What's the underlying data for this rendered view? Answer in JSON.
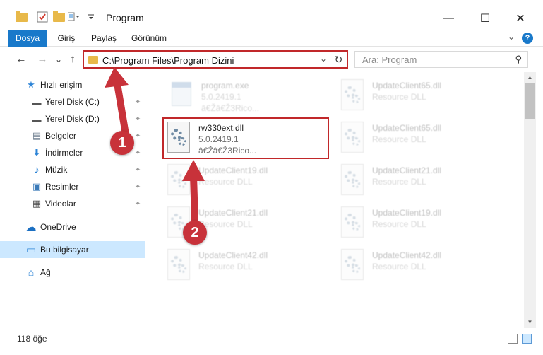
{
  "window": {
    "title": "Program",
    "minimize_glyph": "—",
    "maximize_glyph": "☐",
    "close_glyph": "✕"
  },
  "ribbon": {
    "tabs": [
      {
        "label": "Dosya"
      },
      {
        "label": "Giriş"
      },
      {
        "label": "Paylaş"
      },
      {
        "label": "Görünüm"
      }
    ],
    "help_glyph": "?",
    "collapse_glyph": "⌄"
  },
  "nav": {
    "back": "←",
    "forward": "→",
    "recent": "⌄",
    "up": "↑",
    "address": "C:\\Program Files\\Program Dizini",
    "address_dropdown": "⌄",
    "refresh": "↻",
    "search_placeholder": "Ara: Program",
    "search_glyph": "⚲"
  },
  "sidebar": {
    "items": [
      {
        "label": "Hızlı erişim",
        "icon": "star-icon",
        "glyph": "★",
        "color": "#2d84d6"
      },
      {
        "label": "Yerel Disk (C:)",
        "icon": "drive-icon",
        "glyph": "▬",
        "color": "#555555",
        "pinned": true
      },
      {
        "label": "Yerel Disk (D:)",
        "icon": "drive-icon",
        "glyph": "▬",
        "color": "#555555",
        "pinned": true
      },
      {
        "label": "Belgeler",
        "icon": "documents-icon",
        "glyph": "▤",
        "color": "#6b7b8c",
        "pinned": true
      },
      {
        "label": "İndirmeler",
        "icon": "download-icon",
        "glyph": "⬇",
        "color": "#2d84d6",
        "pinned": true
      },
      {
        "label": "Müzik",
        "icon": "music-icon",
        "glyph": "♪",
        "color": "#2d84d6",
        "pinned": true
      },
      {
        "label": "Resimler",
        "icon": "pictures-icon",
        "glyph": "▣",
        "color": "#3a7ab8",
        "pinned": true
      },
      {
        "label": "Videolar",
        "icon": "videos-icon",
        "glyph": "▦",
        "color": "#444444",
        "pinned": true
      },
      {
        "label": "OneDrive",
        "icon": "cloud-icon",
        "glyph": "☁",
        "color": "#1b6fc2"
      },
      {
        "label": "Bu bilgisayar",
        "icon": "computer-icon",
        "glyph": "▭",
        "color": "#2d84d6",
        "selected": true
      },
      {
        "label": "Ağ",
        "icon": "network-icon",
        "glyph": "⌂",
        "color": "#2d84d6"
      }
    ],
    "pin_glyph": "✦"
  },
  "files": {
    "left": [
      {
        "name": "program.exe",
        "sub1": "5.0.2419.1",
        "sub2": "â€Žâ€Ž3Rico...",
        "kind": "exe",
        "faded": true
      },
      {
        "name": "rw330ext.dll",
        "sub1": "5.0.2419.1",
        "sub2": "â€Žâ€Ž3Rico...",
        "kind": "dll",
        "faded": false
      },
      {
        "name": "UpdateClient19.dll",
        "sub1": "Resource DLL",
        "kind": "dll",
        "faded": true
      },
      {
        "name": "UpdateClient21.dll",
        "sub1": "Resource DLL",
        "kind": "dll",
        "faded": true
      },
      {
        "name": "UpdateClient42.dll",
        "sub1": "Resource DLL",
        "kind": "dll",
        "faded": true
      }
    ],
    "right": [
      {
        "name": "UpdateClient65.dll",
        "sub1": "Resource DLL",
        "kind": "dll",
        "faded": true
      },
      {
        "name": "UpdateClient65.dll",
        "sub1": "Resource DLL",
        "kind": "dll",
        "faded": true
      },
      {
        "name": "UpdateClient21.dll",
        "sub1": "Resource DLL",
        "kind": "dll",
        "faded": true
      },
      {
        "name": "UpdateClient19.dll",
        "sub1": "Resource DLL",
        "kind": "dll",
        "faded": true
      },
      {
        "name": "UpdateClient42.dll",
        "sub1": "Resource DLL",
        "kind": "dll",
        "faded": true
      }
    ]
  },
  "status": {
    "item_count": "118 öğe"
  },
  "callouts": [
    {
      "number": "1"
    },
    {
      "number": "2"
    }
  ],
  "colors": {
    "accent": "#1979ca",
    "callout": "#c8323a",
    "highlight_border": "#c1282a",
    "selection": "#cce8ff"
  }
}
